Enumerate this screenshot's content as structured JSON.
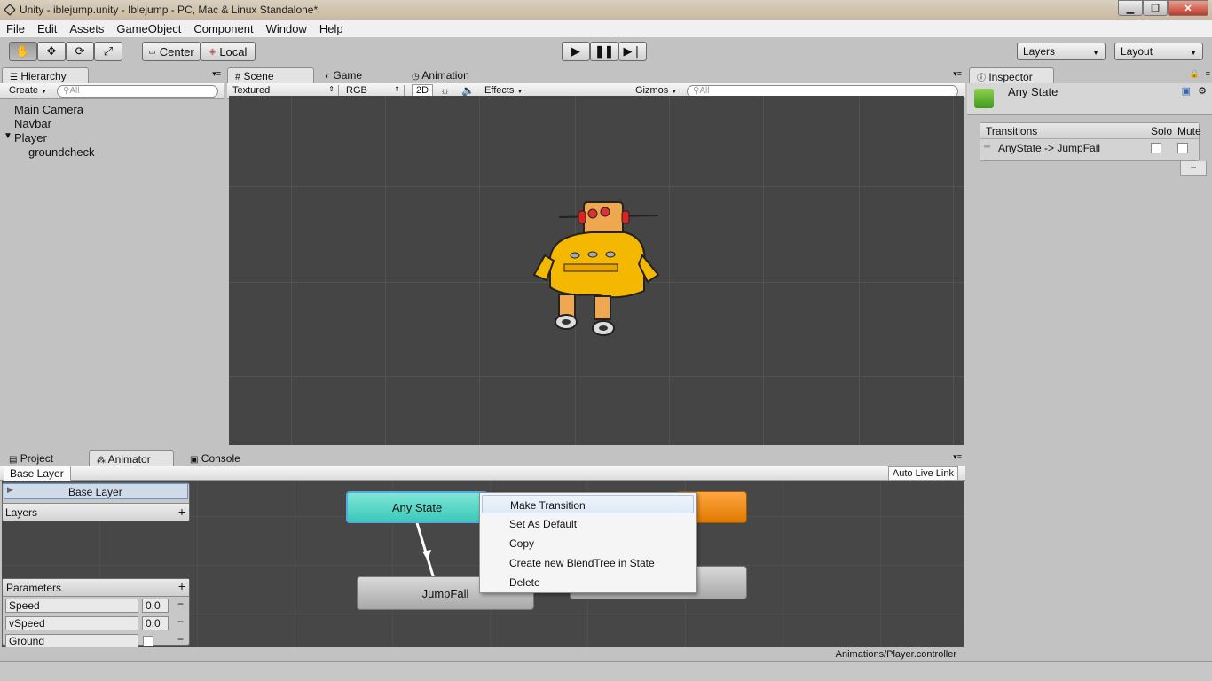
{
  "window": {
    "title": "Unity - iblejump.unity - Iblejump - PC, Mac & Linux Standalone*",
    "minimize": "▁",
    "maximize": "❐",
    "close": "✕"
  },
  "menu": [
    "File",
    "Edit",
    "Assets",
    "GameObject",
    "Component",
    "Window",
    "Help"
  ],
  "toolbar": {
    "pivot": "Center",
    "space": "Local",
    "layers": "Layers",
    "layout": "Layout"
  },
  "hierarchy": {
    "tab": "Hierarchy",
    "create": "Create",
    "search_placeholder": "All",
    "items": [
      {
        "label": "Main Camera"
      },
      {
        "label": "Navbar"
      },
      {
        "label": "Player"
      },
      {
        "label": "groundcheck"
      }
    ]
  },
  "scene": {
    "tabs": [
      "Scene",
      "Game",
      "Animation"
    ],
    "render_mode": "Textured",
    "color_mode": "RGB",
    "mode_2d": "2D",
    "effects": "Effects",
    "gizmos": "Gizmos",
    "search_placeholder": "All"
  },
  "inspector": {
    "tab": "Inspector",
    "object_name": "Any State",
    "transitions_header": "Transitions",
    "solo": "Solo",
    "mute": "Mute",
    "transition": "AnyState -> JumpFall",
    "remove": "−"
  },
  "bottom": {
    "tabs": [
      "Project",
      "Animator",
      "Console"
    ],
    "breadcrumb": "Base Layer",
    "auto_live_link": "Auto Live Link",
    "layer_name": "Base Layer",
    "layers_header": "Layers",
    "parameters_header": "Parameters",
    "parameters": [
      {
        "name": "Speed",
        "value": "0.0"
      },
      {
        "name": "vSpeed",
        "value": "0.0"
      },
      {
        "name": "Ground",
        "value": ""
      }
    ],
    "nodes": {
      "any_state": "Any State",
      "jumpfall": "JumpFall"
    },
    "controller_path": "Animations/Player.controller"
  },
  "context_menu": [
    "Make Transition",
    "Set As Default",
    "Copy",
    "Create new BlendTree in State",
    "Delete"
  ],
  "colors": {
    "any_state": "#3bc9b8",
    "default_state": "#e07a00",
    "scene_bg": "#454545"
  }
}
